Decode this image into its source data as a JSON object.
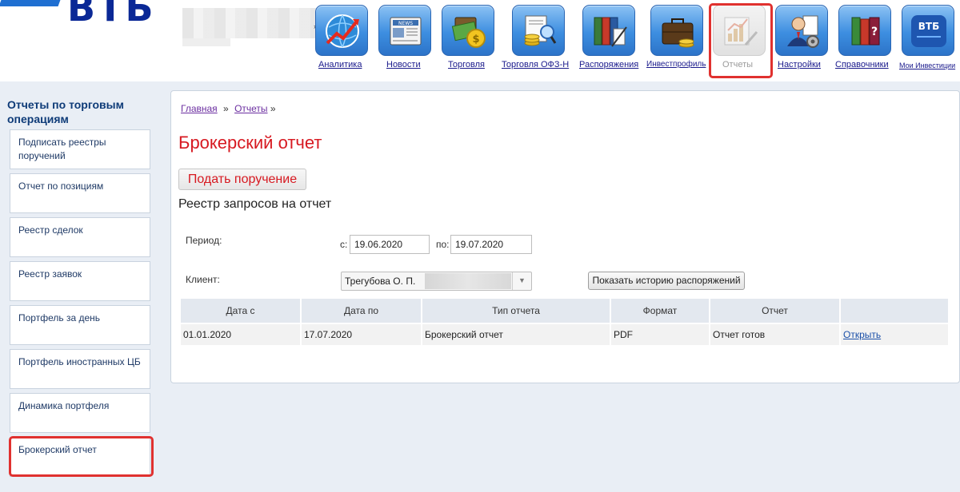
{
  "header": {
    "logo_text": "ВТБ",
    "tiny_mark": "»"
  },
  "nav": [
    {
      "label": "Аналитика",
      "icon": "analytics-chart-icon",
      "state": "normal"
    },
    {
      "label": "Новости",
      "icon": "news-newspaper-icon",
      "state": "normal"
    },
    {
      "label": "Торговля",
      "icon": "trading-money-icon",
      "state": "normal"
    },
    {
      "label": "Торговля ОФЗ-Н",
      "icon": "bonds-coins-icon",
      "state": "normal"
    },
    {
      "label": "Распоряжения",
      "icon": "orders-binders-icon",
      "state": "normal"
    },
    {
      "label": "Инвестпрофиль",
      "icon": "briefcase-coins-icon",
      "state": "normal"
    },
    {
      "label": "Отчеты",
      "icon": "reports-chart-icon",
      "state": "disabled"
    },
    {
      "label": "Настройки",
      "icon": "settings-person-gear-icon",
      "state": "normal"
    },
    {
      "label": "Справочники",
      "icon": "reference-books-icon",
      "state": "normal"
    },
    {
      "label": "Мои Инвестиции",
      "icon": "vtb-logo-icon",
      "state": "normal",
      "tile_text": "ВТБ"
    }
  ],
  "sidebar": {
    "title": "Отчеты по торговым операциям",
    "items": [
      {
        "label": "Подписать реестры поручений"
      },
      {
        "label": "Отчет по позициям"
      },
      {
        "label": "Реестр сделок"
      },
      {
        "label": "Реестр заявок"
      },
      {
        "label": "Портфель за день"
      },
      {
        "label": "Портфель иностранных ЦБ"
      },
      {
        "label": "Динамика портфеля"
      },
      {
        "label": "Брокерский отчет"
      }
    ]
  },
  "main": {
    "breadcrumb": {
      "home": "Главная",
      "sep1": "»",
      "reports": "Отчеты",
      "sep2": "»"
    },
    "title": "Брокерский отчет",
    "order_button": "Подать поручение",
    "section_title": "Реестр запросов на отчет",
    "period_label": "Период:",
    "from_label": "с:",
    "from_value": "19.06.2020",
    "to_label": "по:",
    "to_value": "19.07.2020",
    "client_label": "Клиент:",
    "client_value": "Трегубова О. П.",
    "history_button": "Показать историю распоряжений",
    "table": {
      "headers": [
        "Дата с",
        "Дата по",
        "Тип отчета",
        "Формат",
        "Отчет",
        ""
      ],
      "rows": [
        {
          "date_from": "01.01.2020",
          "date_to": "17.07.2020",
          "type": "Брокерский отчет",
          "format": "PDF",
          "status": "Отчет готов",
          "action": "Открыть"
        }
      ]
    }
  },
  "colors": {
    "accent_red": "#d71921",
    "highlight_red": "#e0312f",
    "brand_blue": "#0a2896",
    "sidebar_bg": "#e9eef5"
  }
}
